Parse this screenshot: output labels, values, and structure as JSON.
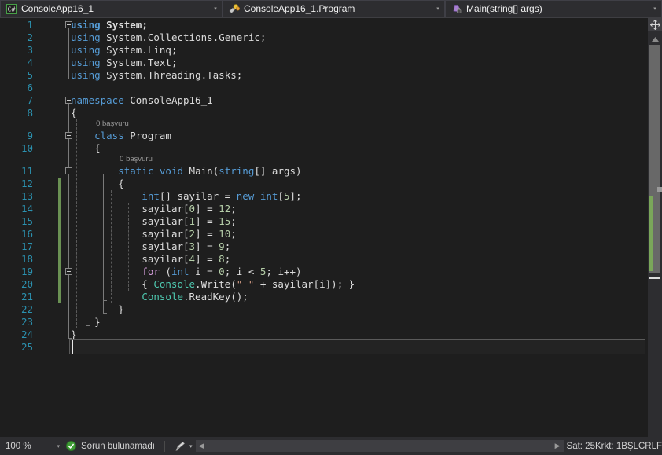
{
  "navbar": {
    "project": {
      "label": "ConsoleApp16_1",
      "icon": "csharp-file-icon",
      "arrow": "▾"
    },
    "class": {
      "label": "ConsoleApp16_1.Program",
      "icon": "class-icon",
      "arrow": "▾"
    },
    "member": {
      "label": "Main(string[] args)",
      "icon": "method-private-icon",
      "arrow": "▾"
    }
  },
  "editor": {
    "language": "csharp",
    "line_count": 25,
    "codelens": [
      {
        "line": 9,
        "text": "0 başvuru"
      },
      {
        "line": 11,
        "text": "0 başvuru"
      }
    ],
    "lines": [
      {
        "n": 1,
        "indent": 0,
        "text": "using System;"
      },
      {
        "n": 2,
        "indent": 0,
        "text": "using System.Collections.Generic;"
      },
      {
        "n": 3,
        "indent": 0,
        "text": "using System.Linq;"
      },
      {
        "n": 4,
        "indent": 0,
        "text": "using System.Text;"
      },
      {
        "n": 5,
        "indent": 0,
        "text": "using System.Threading.Tasks;"
      },
      {
        "n": 6,
        "indent": 0,
        "text": ""
      },
      {
        "n": 7,
        "indent": 0,
        "text": "namespace ConsoleApp16_1"
      },
      {
        "n": 8,
        "indent": 0,
        "text": "{"
      },
      {
        "n": 9,
        "indent": 1,
        "text": "class Program"
      },
      {
        "n": 10,
        "indent": 1,
        "text": "{"
      },
      {
        "n": 11,
        "indent": 2,
        "text": "static void Main(string[] args)"
      },
      {
        "n": 12,
        "indent": 2,
        "text": "{"
      },
      {
        "n": 13,
        "indent": 3,
        "text": "int[] sayilar = new int[5];"
      },
      {
        "n": 14,
        "indent": 3,
        "text": "sayilar[0] = 12;"
      },
      {
        "n": 15,
        "indent": 3,
        "text": "sayilar[1] = 15;"
      },
      {
        "n": 16,
        "indent": 3,
        "text": "sayilar[2] = 10;"
      },
      {
        "n": 17,
        "indent": 3,
        "text": "sayilar[3] = 9;"
      },
      {
        "n": 18,
        "indent": 3,
        "text": "sayilar[4] = 8;"
      },
      {
        "n": 19,
        "indent": 3,
        "text": "for (int i = 0; i < 5; i++)"
      },
      {
        "n": 20,
        "indent": 3,
        "text": "{ Console.Write(\" \" + sayilar[i]); }"
      },
      {
        "n": 21,
        "indent": 3,
        "text": "Console.ReadKey();"
      },
      {
        "n": 22,
        "indent": 2,
        "text": "}"
      },
      {
        "n": 23,
        "indent": 1,
        "text": "}"
      },
      {
        "n": 24,
        "indent": 0,
        "text": "}"
      },
      {
        "n": 25,
        "indent": 0,
        "text": ""
      }
    ],
    "fold_lines": [
      1,
      7,
      9,
      11,
      19
    ],
    "cursor_line": 25,
    "changed_lines": [
      12,
      13,
      14,
      15,
      16,
      17,
      18,
      19,
      20,
      21
    ]
  },
  "colors": {
    "background": "#1e1e1e",
    "line_number": "#2b91af",
    "keyword": "#569cd6",
    "control_keyword": "#d8a0df",
    "type": "#4ec9b0",
    "number": "#b5cea8",
    "string": "#d69d85",
    "identifier": "#dcdcdc",
    "change_bar": "#6a9153",
    "status_bar": "#2d2d30",
    "ok_badge": "#3f9c35"
  },
  "statusbar": {
    "zoom": "100 %",
    "zoom_arrow": "▾",
    "status_text": "Sorun bulunamadı",
    "status_icon": "check-circle-icon",
    "brush_icon": "brush-icon",
    "brush_arrow": "▾",
    "scroll_left": "◀",
    "scroll_right": "▶",
    "line_label": "Sat: 25",
    "col_label": "Krkt: 1",
    "insert_mode": "BŞL",
    "line_ending": "CRLF"
  },
  "scrollbar": {
    "splitter_icon": "split-view-icon",
    "up_arrow": "▲"
  }
}
